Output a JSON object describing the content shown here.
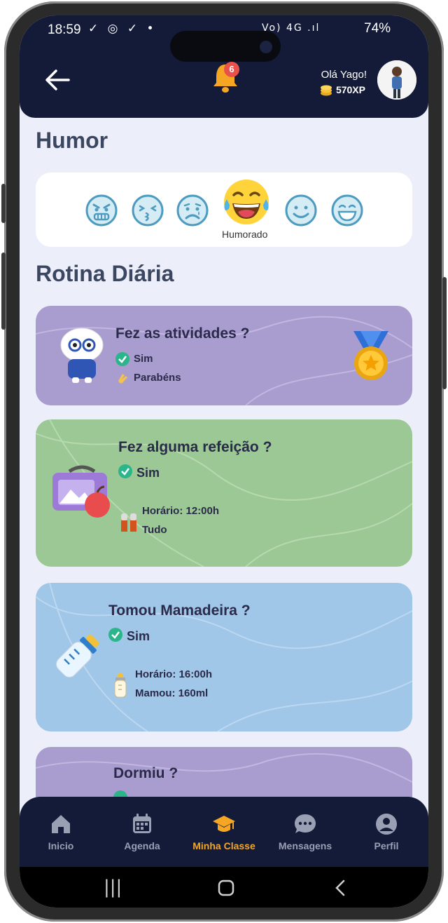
{
  "status_bar": {
    "time": "18:59",
    "left_icons": "✓ ◎ ✓ •",
    "network": "Vo) 4G .ıl",
    "battery": "74%"
  },
  "header": {
    "notification_count": "6",
    "greeting": "Olá Yago!",
    "xp": "570XP"
  },
  "mood": {
    "section_title": "Humor",
    "faces": [
      "angry-face-icon",
      "kissing-face-icon",
      "sad-face-icon",
      "laughing-tears-face-icon",
      "smiling-face-icon",
      "grinning-face-icon"
    ],
    "selected_label": "Humorado"
  },
  "routine": {
    "section_title": "Rotina Diária",
    "activities": {
      "title": "Fez as atividades ?",
      "answer": "Sim",
      "praise": "Parabéns",
      "color": "#a99ccf"
    },
    "meal": {
      "title": "Fez alguma refeição ?",
      "answer": "Sim",
      "time": "Horário: 12:00h",
      "amount": "Tudo",
      "color": "#9bc894"
    },
    "bottle": {
      "title": "Tomou Mamadeira ?",
      "answer": "Sim",
      "time": "Horário: 16:00h",
      "amount": "Mamou: 160ml",
      "color": "#a0c6e8"
    },
    "sleep": {
      "title": "Dormiu ?",
      "color": "#a99ccf"
    }
  },
  "bottom_nav": {
    "items": [
      {
        "label": "Inicio",
        "icon": "home-icon"
      },
      {
        "label": "Agenda",
        "icon": "calendar-icon"
      },
      {
        "label": "Minha Classe",
        "icon": "graduation-cap-icon",
        "active": true
      },
      {
        "label": "Mensagens",
        "icon": "chat-bubble-icon"
      },
      {
        "label": "Perfil",
        "icon": "user-circle-icon"
      }
    ]
  },
  "colors": {
    "header_bg": "#131b38",
    "accent": "#f5a623",
    "screen_bg": "#eceef9"
  }
}
